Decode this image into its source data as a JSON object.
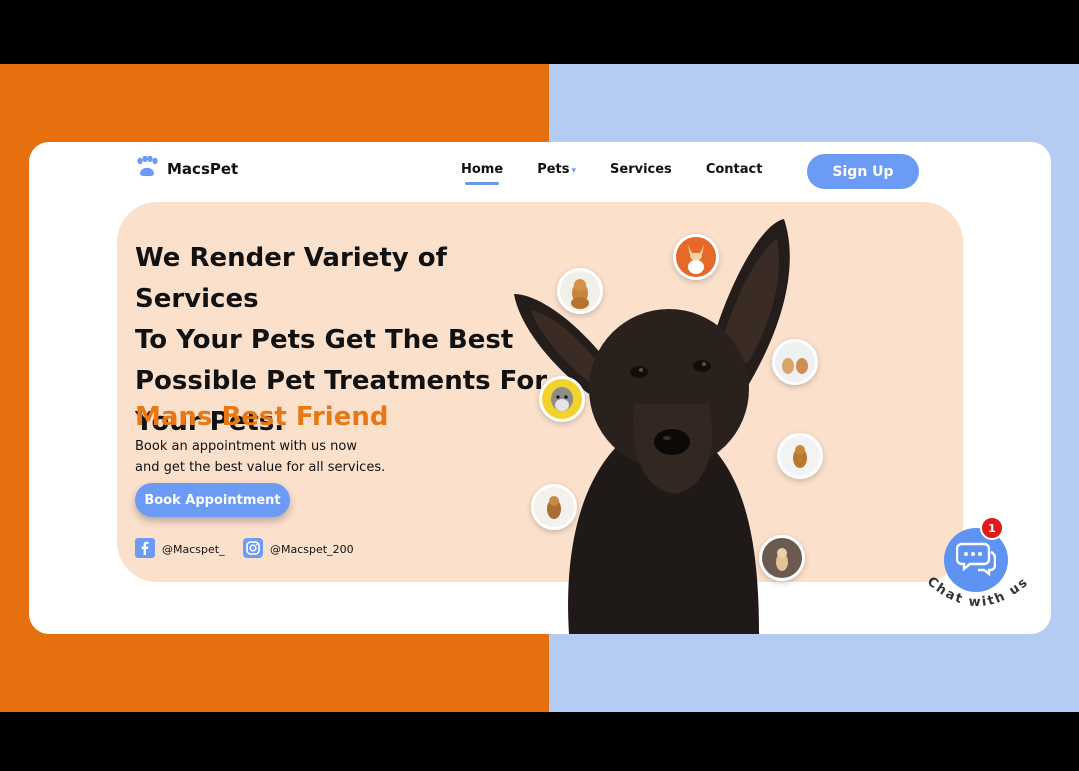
{
  "brand": {
    "name": "MacsPet",
    "logo_icon": "paw-icon",
    "accent": "#6b9bf5",
    "orange": "#e77814"
  },
  "nav": {
    "items": [
      {
        "label": "Home",
        "active": true
      },
      {
        "label": "Pets",
        "has_dropdown": true
      },
      {
        "label": "Services"
      },
      {
        "label": "Contact"
      }
    ],
    "signup_label": "Sign Up"
  },
  "hero": {
    "headline_lines": [
      "We Render Variety of Services",
      "To Your Pets Get The Best",
      "Possible Pet Treatments For",
      "Your Pets."
    ],
    "tagline": "Mans Best Friend",
    "description_lines": [
      "Book an appointment with us now",
      "and get the best value for all services."
    ],
    "cta_label": "Book Appointment",
    "socials": [
      {
        "icon": "facebook-icon",
        "handle": "@Macspet_"
      },
      {
        "icon": "instagram-icon",
        "handle": "@Macspet_200"
      }
    ]
  },
  "chat": {
    "badge_count": "1",
    "label": "Chat with us",
    "icon": "chat-bubbles-icon"
  }
}
